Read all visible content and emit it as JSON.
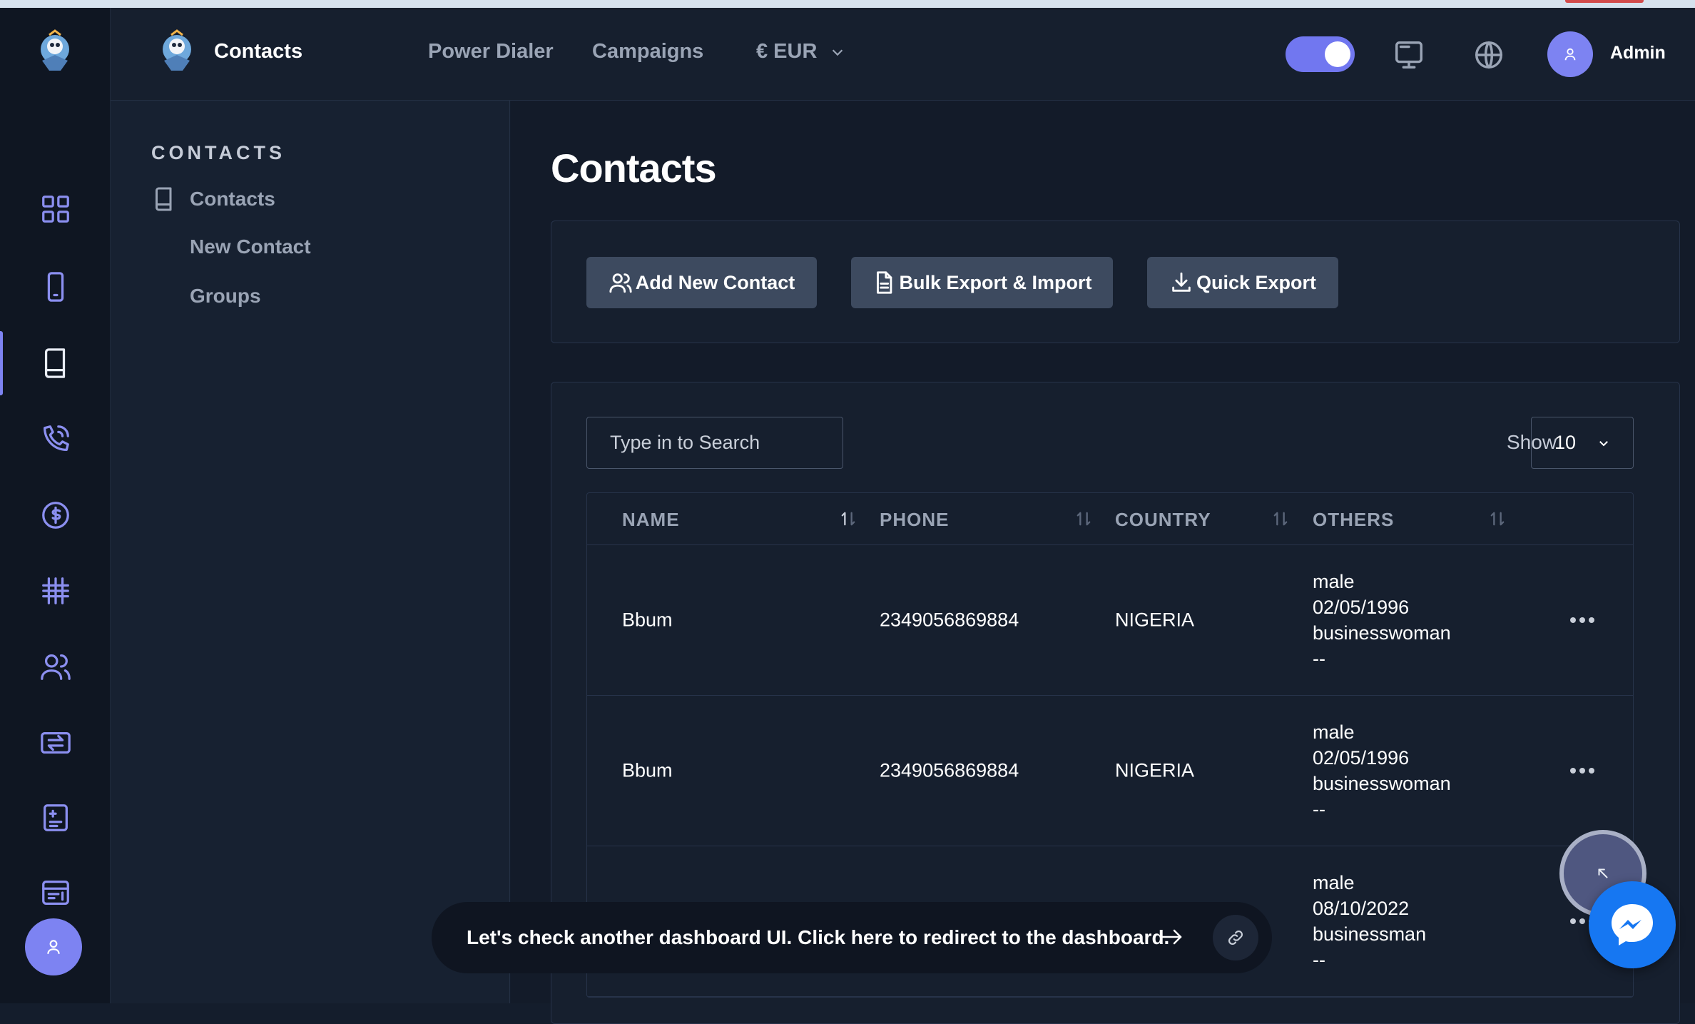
{
  "header": {
    "title": "Contacts",
    "nav": [
      "Power Dialer",
      "Campaigns"
    ],
    "currency": "€ EUR",
    "user_name": "Admin"
  },
  "sidebar": {
    "section_title": "CONTACTS",
    "items": [
      {
        "label": "Contacts"
      },
      {
        "label": "New Contact"
      },
      {
        "label": "Groups"
      }
    ]
  },
  "rail": {
    "icons": [
      "dashboard-icon",
      "phone-device-icon",
      "contacts-book-icon",
      "phone-call-icon",
      "dollar-icon",
      "hashtag-icon",
      "users-icon",
      "transfer-icon",
      "report-icon",
      "calendar-list-icon"
    ],
    "active": "contacts-book-icon"
  },
  "main": {
    "title": "Contacts",
    "actions": {
      "add": "Add New Contact",
      "bulk": "Bulk Export & Import",
      "quick": "Quick Export"
    },
    "search_placeholder": "Type in to Search",
    "show_label": "Show",
    "page_size": "10",
    "columns": [
      "NAME",
      "PHONE",
      "COUNTRY",
      "OTHERS"
    ],
    "rows": [
      {
        "name": "Bbum",
        "phone": "2349056869884",
        "country": "NIGERIA",
        "others": [
          "male",
          "02/05/1996",
          "businesswoman",
          "--"
        ]
      },
      {
        "name": "Bbum",
        "phone": "2349056869884",
        "country": "NIGERIA",
        "others": [
          "male",
          "02/05/1996",
          "businesswoman",
          "--"
        ]
      },
      {
        "name": "",
        "phone": "",
        "country": "",
        "others": [
          "male",
          "08/10/2022",
          "businessman",
          "--"
        ]
      }
    ]
  },
  "banner": {
    "text": "Let's check another dashboard UI. Click here to redirect to the dashboard."
  },
  "colors": {
    "accent": "#7d83f2",
    "background": "#131b29",
    "button": "#3d4a5f",
    "messenger": "#1677f2"
  }
}
